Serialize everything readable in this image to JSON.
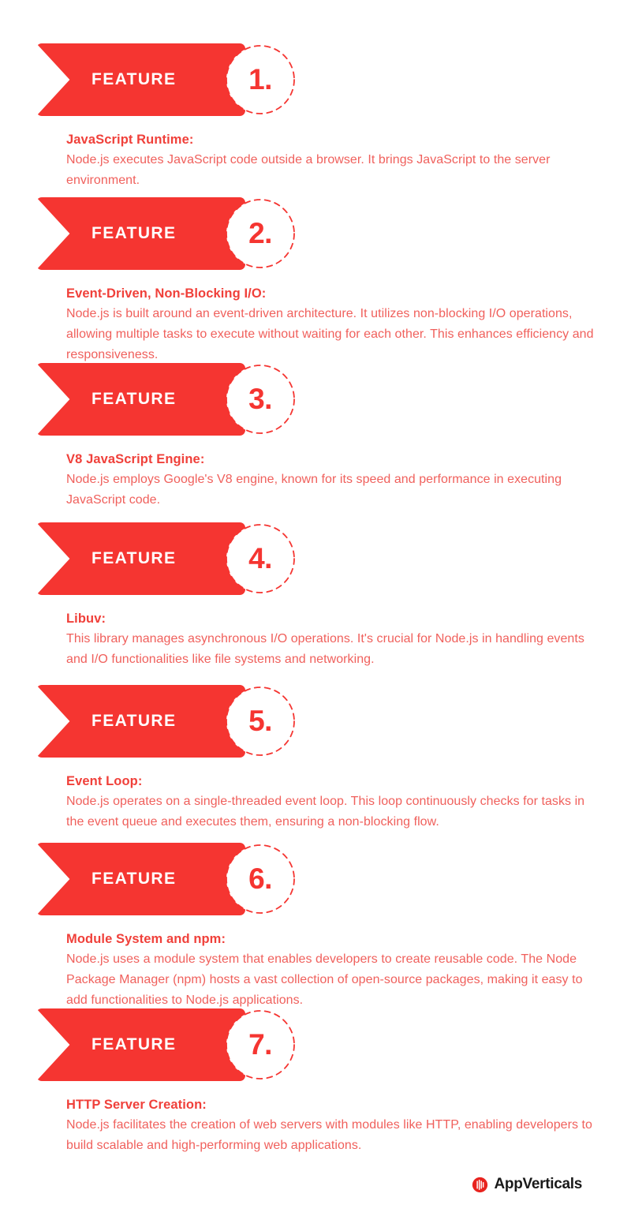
{
  "theme": {
    "banner_red": "#F53531",
    "title_red": "#F0403A",
    "body_red": "#F0605C",
    "background": "#FFFFFF",
    "label_color": "#FFFFFF",
    "logo_text_color": "#1A1A1A"
  },
  "features": [
    {
      "badge_label": "FEATURE",
      "number": "1.",
      "title": "JavaScript Runtime:",
      "description": "Node.js executes JavaScript code outside a browser. It brings JavaScript to the server environment."
    },
    {
      "badge_label": "FEATURE",
      "number": "2.",
      "title": "Event-Driven, Non-Blocking I/O:",
      "description": "Node.js is built around an event-driven architecture. It utilizes non-blocking I/O operations, allowing multiple tasks to execute without waiting for each other. This enhances efficiency and responsiveness."
    },
    {
      "badge_label": "FEATURE",
      "number": "3.",
      "title": "V8 JavaScript Engine:",
      "description": "Node.js employs Google's V8 engine, known for its speed and performance in executing JavaScript code."
    },
    {
      "badge_label": "FEATURE",
      "number": "4.",
      "title": "Libuv:",
      "description": "This library manages asynchronous I/O operations. It's crucial for Node.js in handling events and I/O functionalities like file systems and networking."
    },
    {
      "badge_label": "FEATURE",
      "number": "5.",
      "title": "Event Loop:",
      "description": "Node.js operates on a single-threaded event loop. This loop continuously checks for tasks in the event queue and executes them, ensuring a non-blocking flow."
    },
    {
      "badge_label": "FEATURE",
      "number": "6.",
      "title": "Module System and npm:",
      "description": "Node.js uses a module system that enables developers to create reusable code. The Node Package Manager (npm) hosts a vast collection of open-source packages, making it easy to add functionalities to Node.js applications."
    },
    {
      "badge_label": "FEATURE",
      "number": "7.",
      "title": "HTTP Server Creation:",
      "description": "Node.js facilitates the creation of web servers with modules like HTTP, enabling developers to build scalable and high-performing web applications."
    }
  ],
  "footer": {
    "brand_name": "AppVerticals",
    "logo_icon": "appverticals-circle-bars-icon"
  }
}
